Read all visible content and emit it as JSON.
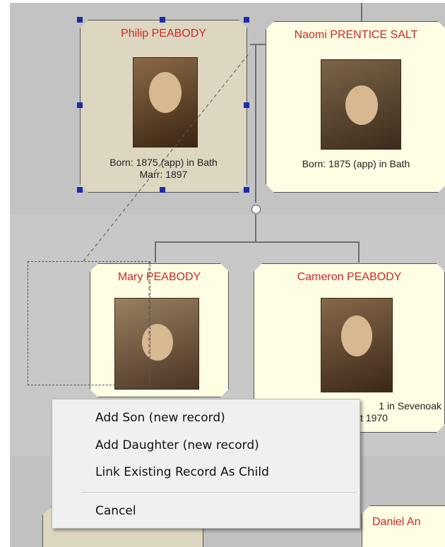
{
  "cards": {
    "philip": {
      "name": "Philip  PEABODY",
      "detail1": "Born: 1875 (app) in Bath",
      "detail2": "Marr: 1897"
    },
    "naomi": {
      "name": "Naomi PRENTICE SALT",
      "detail1": "Born: 1875 (app) in Bath"
    },
    "mary": {
      "name": "Mary  PEABODY"
    },
    "cameron": {
      "name": "Cameron PEABODY",
      "detail1": "1 in Sevenoak",
      "detail2": "t 1970"
    },
    "daniel": {
      "name": "Daniel An"
    }
  },
  "context_menu": {
    "items": [
      "Add Son (new record)",
      "Add Daughter (new record)",
      "Link Existing Record As Child",
      "Cancel"
    ]
  },
  "icons": {
    "connector": "marriage-circle-icon"
  },
  "colors": {
    "name_text": "#cc2a2a",
    "selected_card": "#ddd6c0",
    "card": "#fffde3",
    "handle": "#1c2ca8"
  }
}
